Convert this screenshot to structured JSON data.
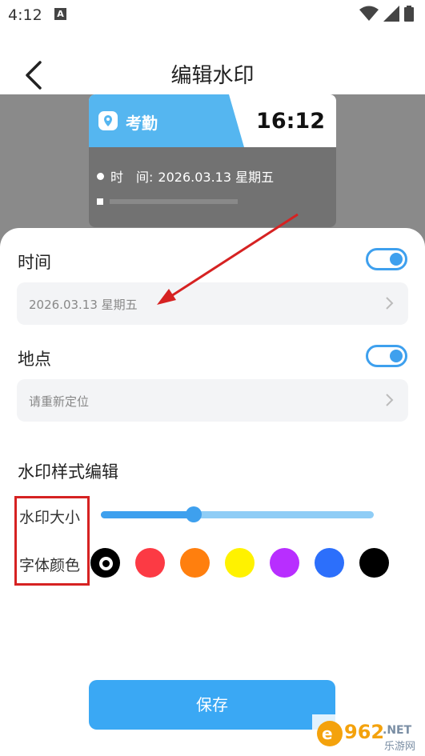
{
  "status_bar": {
    "time": "4:12",
    "notification_glyph": "A",
    "icons": [
      "wifi-icon",
      "signal-icon",
      "battery-icon"
    ]
  },
  "header": {
    "title": "编辑水印",
    "back_icon": "back-arrow-icon"
  },
  "preview": {
    "tag": "考勤",
    "time": "16:12",
    "row1_label": "时　间:",
    "row1_value": "2026.03.13 星期五"
  },
  "sections": {
    "time": {
      "label": "时间",
      "value": "2026.03.13 星期五",
      "enabled": true
    },
    "location": {
      "label": "地点",
      "placeholder": "请重新定位",
      "enabled": true
    }
  },
  "style_editor": {
    "title": "水印样式编辑",
    "size_label": "水印大小",
    "size_level": 0.34,
    "color_label": "字体颜色",
    "colors": [
      "#ffffff",
      "#fc3a44",
      "#ff7f0e",
      "#fff200",
      "#b82eff",
      "#2c6ffb",
      "#000000"
    ],
    "selected_color_index": 0
  },
  "save_label": "保存",
  "logo_text": {
    "main": "962",
    "tld": ".NET",
    "sub": "乐游网"
  },
  "accent_color": "#3ea0ee",
  "annotation_color": "#d62222"
}
